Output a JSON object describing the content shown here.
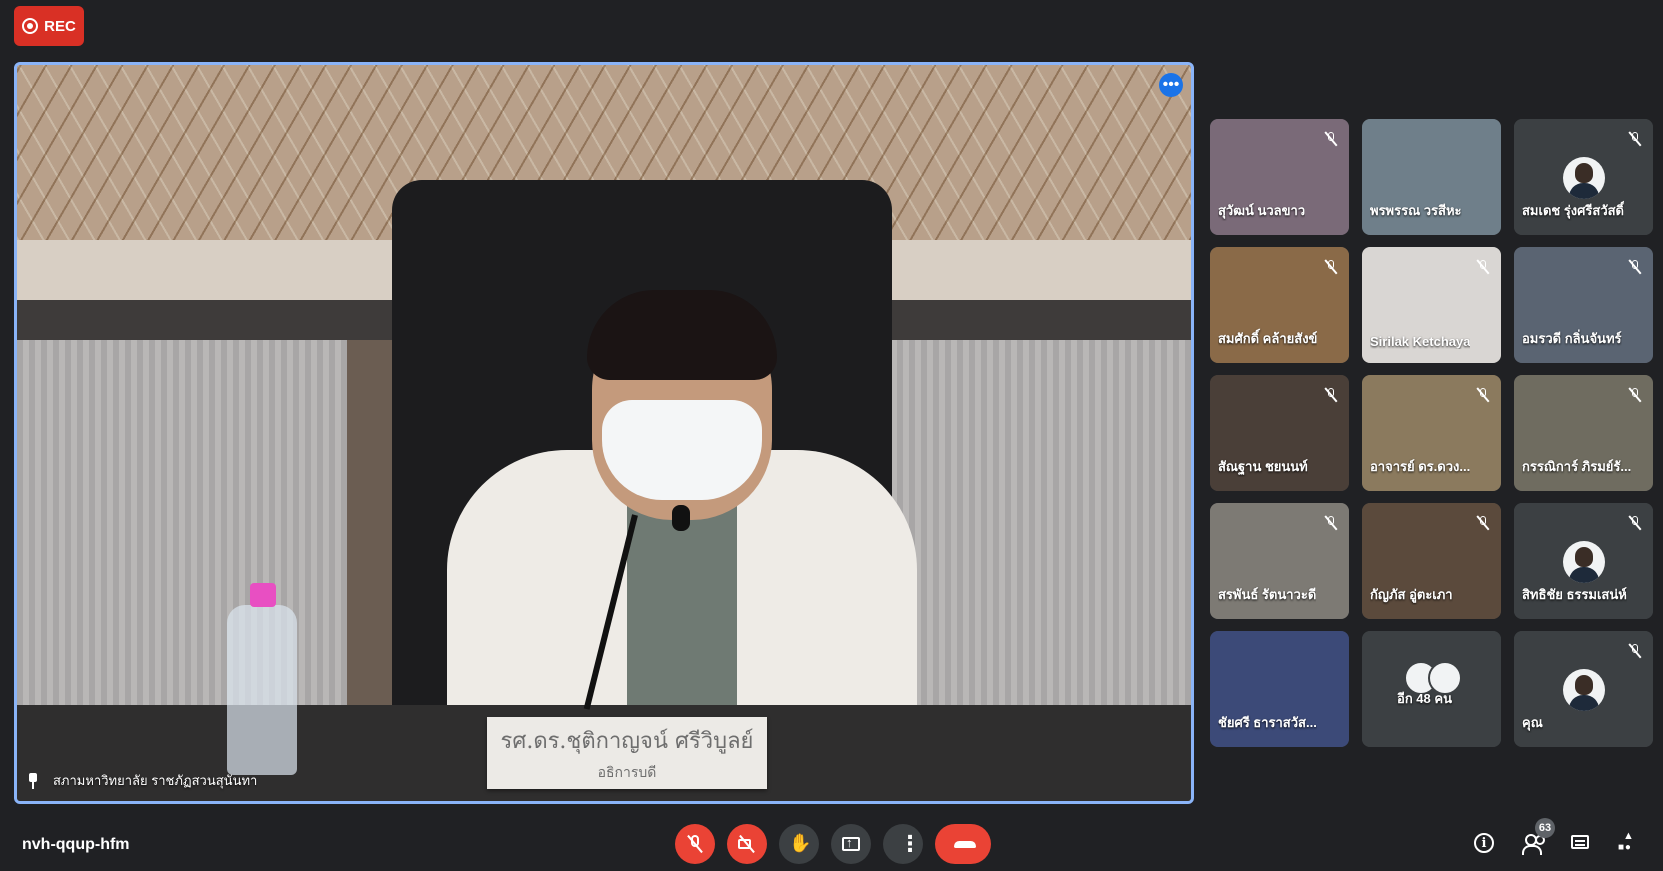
{
  "recording": {
    "label": "REC"
  },
  "main_video": {
    "presenter_label": "สภามหาวิทยาลัย ราชภัฏสวนสุนันทา",
    "nameplate_name": "รศ.ดร.ชุติกาญจน์ ศรีวิบูลย์",
    "nameplate_title": "อธิการบดี"
  },
  "participants": [
    {
      "name": "สุวัฒน์ นวลขาว",
      "muted": true,
      "bg": "#7a6a78"
    },
    {
      "name": "พรพรรณ วรสีหะ",
      "muted": false,
      "bg": "#6f7f8a"
    },
    {
      "name": "สมเดช รุ่งศรีสวัสดิ์",
      "muted": true,
      "bg": "#3c4043",
      "avatar": true
    },
    {
      "name": "สมศักดิ์ คล้ายสังข์",
      "muted": true,
      "bg": "#8a6a48"
    },
    {
      "name": "Sirilak Ketchaya",
      "muted": true,
      "bg": "#d9d6d3"
    },
    {
      "name": "อมรวดี กลิ่นจันทร์",
      "muted": true,
      "bg": "#5a6472"
    },
    {
      "name": "สัณฐาน ชยนนท์",
      "muted": true,
      "bg": "#4a3f38"
    },
    {
      "name": "อาจารย์ ดร.ดวง...",
      "muted": true,
      "bg": "#8b7a5e"
    },
    {
      "name": "กรรณิการ์ ภิรมย์รั...",
      "muted": true,
      "bg": "#6f6c60"
    },
    {
      "name": "สรพันธ์ รัตนาวะดี",
      "muted": true,
      "bg": "#7d7a74"
    },
    {
      "name": "กัญภัส อู่ตะเภา",
      "muted": true,
      "bg": "#5b4a3c"
    },
    {
      "name": "สิทธิชัย ธรรมเสน่ห์",
      "muted": true,
      "bg": "#3c4043",
      "avatar": true
    },
    {
      "name": "ชัยศรี ธาราสวัส...",
      "muted": false,
      "bg": "#3c4a78"
    },
    {
      "name": "อีก 48 คน",
      "muted": false,
      "bg": "#3c4043",
      "more": true
    },
    {
      "name": "คุณ",
      "muted": true,
      "bg": "#3c4043",
      "avatar": true
    }
  ],
  "bottom_bar": {
    "meeting_code": "nvh-qqup-hfm",
    "people_count": "63"
  },
  "colors": {
    "accent_blue": "#8ab4f8",
    "danger_red": "#ea4335",
    "bg_dark": "#202124",
    "tile_bg": "#3c4043"
  }
}
